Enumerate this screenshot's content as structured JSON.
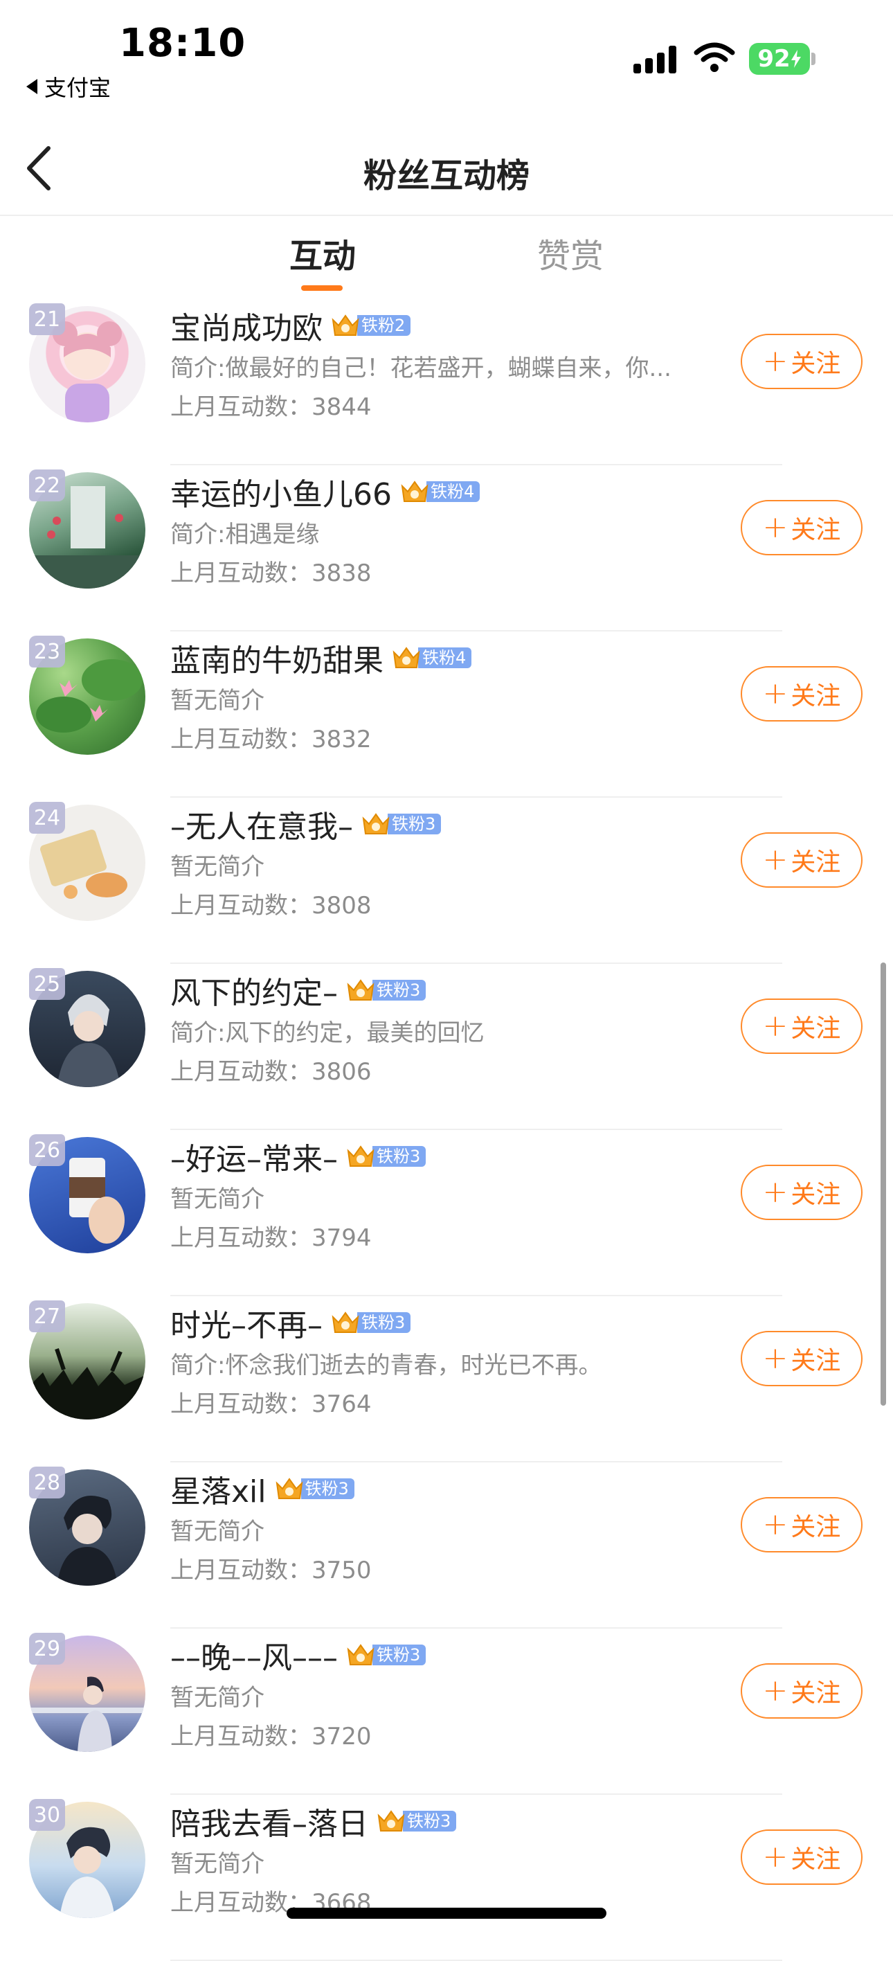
{
  "status_bar": {
    "time": "18:10",
    "back_app": "支付宝",
    "battery": "92"
  },
  "nav": {
    "title": "粉丝互动榜"
  },
  "tabs": [
    {
      "label": "互动",
      "active": true
    },
    {
      "label": "赞赏",
      "active": false
    }
  ],
  "follow_label": "关注",
  "accent_color": "#ff7a1a",
  "rows": [
    {
      "rank": "21",
      "name": "宝尚成功欧",
      "badge": "铁粉2",
      "bio": "简介:做最好的自己！花若盛开，蝴蝶自来，你...",
      "count": "上月互动数：3844"
    },
    {
      "rank": "22",
      "name": "幸运的小鱼儿66",
      "badge": "铁粉4",
      "bio": "简介:相遇是缘",
      "count": "上月互动数：3838"
    },
    {
      "rank": "23",
      "name": "蓝南的牛奶甜果",
      "badge": "铁粉4",
      "bio": "暂无简介",
      "count": "上月互动数：3832"
    },
    {
      "rank": "24",
      "name": "–无人在意我–",
      "badge": "铁粉3",
      "bio": "暂无简介",
      "count": "上月互动数：3808"
    },
    {
      "rank": "25",
      "name": "风下的约定–",
      "badge": "铁粉3",
      "bio": "简介:风下的约定，最美的回忆",
      "count": "上月互动数：3806"
    },
    {
      "rank": "26",
      "name": "–好运–常来–",
      "badge": "铁粉3",
      "bio": "暂无简介",
      "count": "上月互动数：3794"
    },
    {
      "rank": "27",
      "name": "时光–不再–",
      "badge": "铁粉3",
      "bio": "简介:怀念我们逝去的青春，时光已不再。",
      "count": "上月互动数：3764"
    },
    {
      "rank": "28",
      "name": "星落xil",
      "badge": "铁粉3",
      "bio": "暂无简介",
      "count": "上月互动数：3750"
    },
    {
      "rank": "29",
      "name": "––晚––风–––",
      "badge": "铁粉3",
      "bio": "暂无简介",
      "count": "上月互动数：3720"
    },
    {
      "rank": "30",
      "name": "陪我去看–落日",
      "badge": "铁粉3",
      "bio": "暂无简介",
      "count": "上月互动数：3668"
    }
  ]
}
